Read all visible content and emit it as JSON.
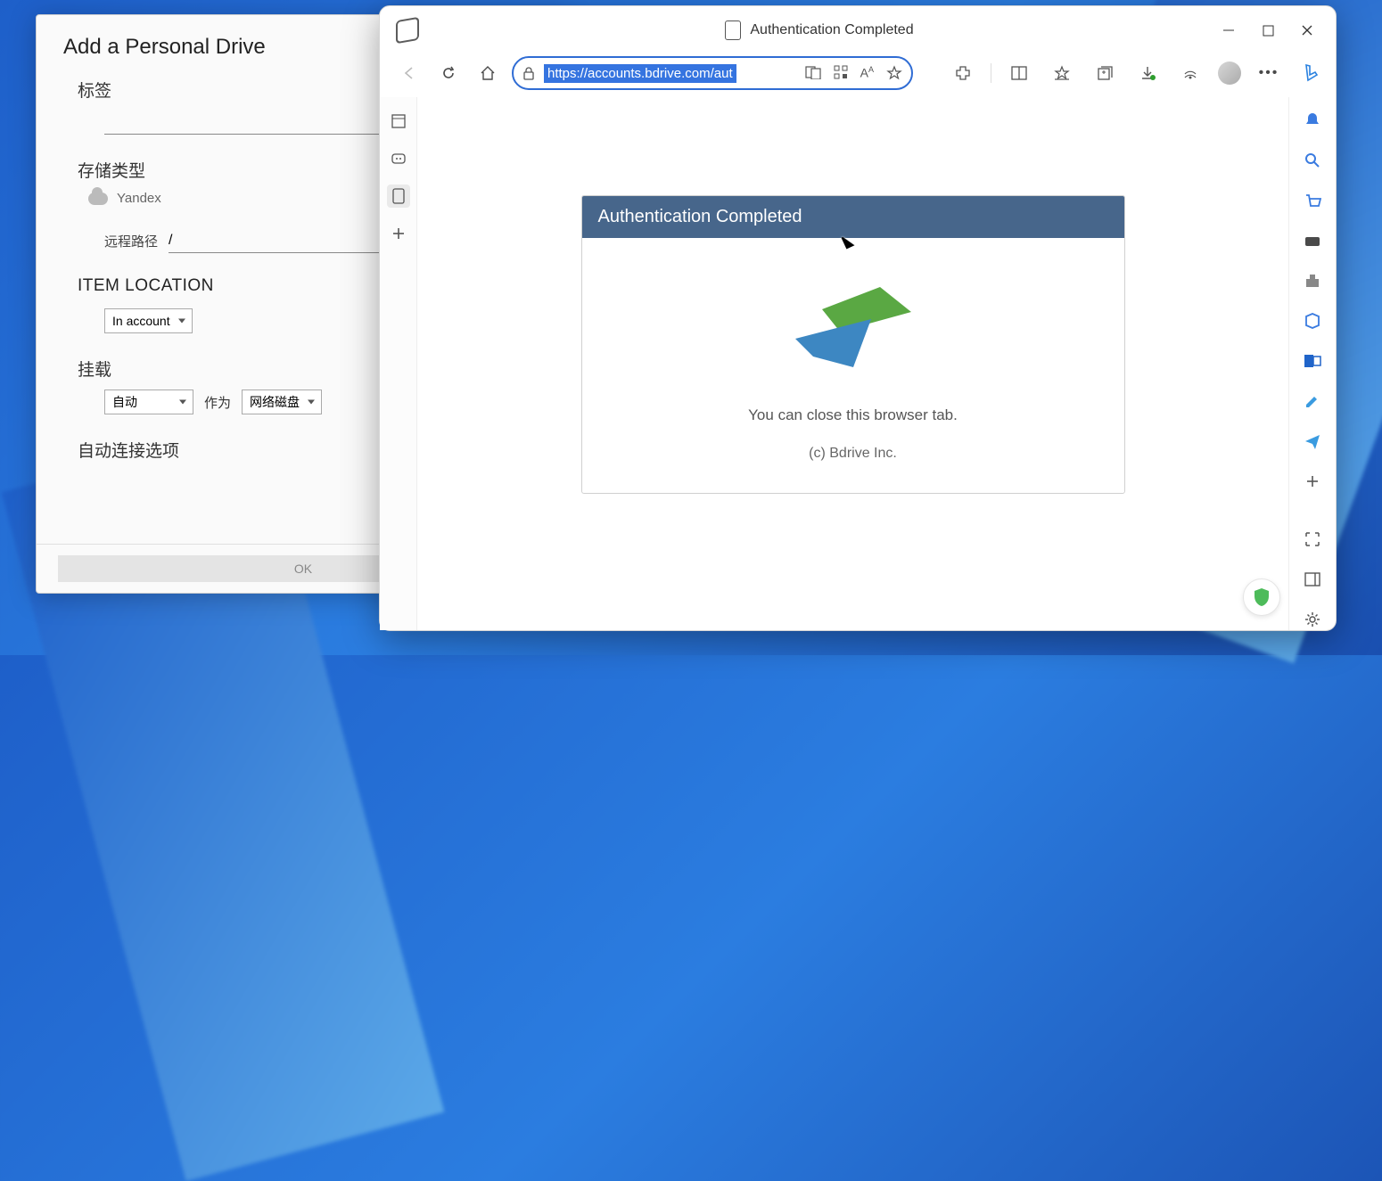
{
  "dlg": {
    "title": "Add a Personal Drive",
    "label_label": "标签",
    "storage_label": "存储类型",
    "storage_value": "Yandex",
    "remote_path_label": "远程路径",
    "remote_path_value": "/",
    "item_location_heading": "ITEM LOCATION",
    "item_location_value": "In account",
    "mount_heading": "挂载",
    "mount_value": "自动",
    "as_label": "作为",
    "mount_type_value": "网络磁盘",
    "autoconnect_heading": "自动连接选项",
    "ok_label": "OK"
  },
  "browser": {
    "tab_title": "Authentication Completed",
    "url": "https://accounts.bdrive.com/aut"
  },
  "card": {
    "heading": "Authentication Completed",
    "message": "You can close this browser tab.",
    "copyright": "(c) Bdrive Inc."
  }
}
